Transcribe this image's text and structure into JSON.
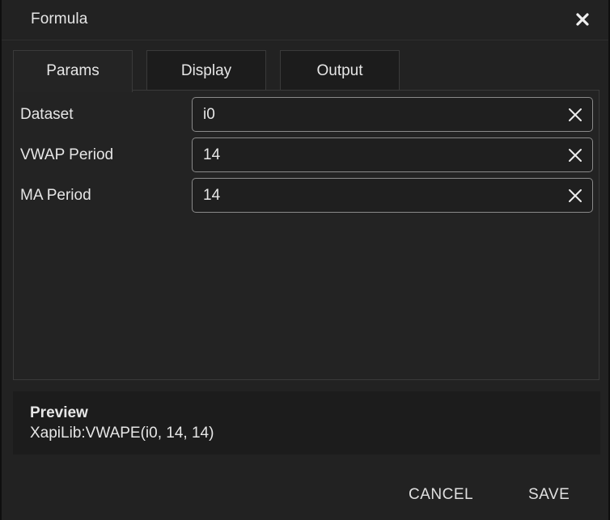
{
  "dialog": {
    "title": "Formula"
  },
  "tabs": [
    {
      "label": "Params",
      "active": true
    },
    {
      "label": "Display",
      "active": false
    },
    {
      "label": "Output",
      "active": false
    }
  ],
  "params": [
    {
      "label": "Dataset",
      "value": "i0"
    },
    {
      "label": "VWAP Period",
      "value": "14"
    },
    {
      "label": "MA Period",
      "value": "14"
    }
  ],
  "preview": {
    "label": "Preview",
    "value": "XapiLib:VWAPE(i0, 14, 14)"
  },
  "footer": {
    "cancel_label": "CANCEL",
    "save_label": "SAVE"
  },
  "icons": {
    "close": "close-icon",
    "clear": "clear-icon"
  },
  "colors": {
    "background": "#222222",
    "text": "#e6e6e6",
    "input_border": "#8a8a8a"
  }
}
